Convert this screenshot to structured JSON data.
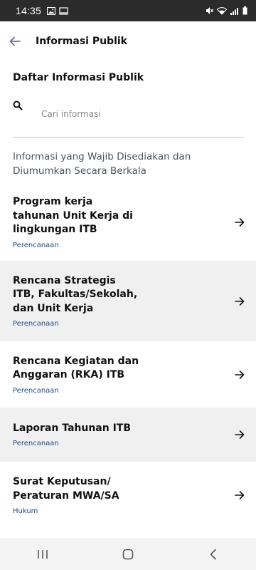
{
  "status_bar": {
    "time": "14:35",
    "left_icons": [
      "image-icon",
      "screen-cast-icon"
    ],
    "right_icons": [
      "mute-icon",
      "wifi-icon",
      "signal-icon",
      "battery-icon"
    ]
  },
  "app_bar": {
    "title": "Informasi Publik"
  },
  "section": {
    "title": "Daftar Informasi Publik"
  },
  "search": {
    "placeholder": "Cari informasi",
    "value": ""
  },
  "category_heading": "Informasi yang Wajib Disediakan dan Diumumkan Secara Berkala",
  "items": [
    {
      "name": "Program kerja tahunan Unit Kerja di lingkungan ITB",
      "category": "Perencanaan"
    },
    {
      "name": "Rencana Strategis ITB, Fakultas/Sekolah, dan Unit Kerja",
      "category": "Perencanaan"
    },
    {
      "name": "Rencana Kegiatan dan Anggaran (RKA) ITB",
      "category": "Perencanaan"
    },
    {
      "name": "Laporan Tahunan ITB",
      "category": "Perencanaan"
    },
    {
      "name": "Surat Keputusan/ Peraturan MWA/SA",
      "category": "Hukum"
    }
  ],
  "colors": {
    "status_bar_bg": "#2b2b2b",
    "accent_back": "#6b6f9e",
    "category_text": "#1d4a8a",
    "alt_row_bg": "#f0f0f0"
  },
  "nav_bar": [
    "recent-apps-icon",
    "home-icon",
    "back-icon"
  ]
}
